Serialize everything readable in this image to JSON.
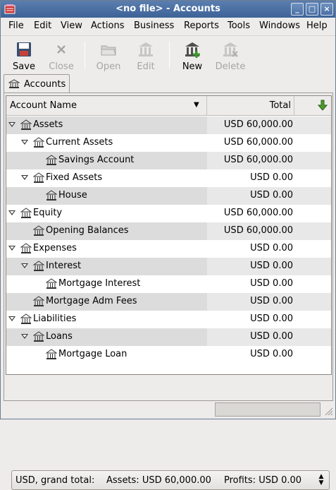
{
  "window": {
    "title": "<no file> - Accounts",
    "controls": {
      "minimize": "_",
      "maximize": "□",
      "close": "×"
    }
  },
  "menubar": [
    "File",
    "Edit",
    "View",
    "Actions",
    "Business",
    "Reports",
    "Tools",
    "Windows",
    "Help"
  ],
  "toolbar": {
    "save": {
      "label": "Save",
      "icon": "floppy-disk-icon",
      "enabled": true
    },
    "close": {
      "label": "Close",
      "icon": "close-x-icon",
      "enabled": false
    },
    "open": {
      "label": "Open",
      "icon": "folder-open-icon",
      "enabled": false
    },
    "edit": {
      "label": "Edit",
      "icon": "account-edit-icon",
      "enabled": false
    },
    "new": {
      "label": "New",
      "icon": "account-new-icon",
      "enabled": true
    },
    "delete": {
      "label": "Delete",
      "icon": "account-delete-icon",
      "enabled": false
    }
  },
  "tab": {
    "label": "Accounts",
    "icon": "bank-icon"
  },
  "columns": {
    "name": "Account Name",
    "total": "Total",
    "name_sort_icon": "chevron-down-icon",
    "selector_icon": "green-down-arrow-icon"
  },
  "accounts": [
    {
      "name": "Assets",
      "total": "USD 60,000.00",
      "level": 0,
      "expanded": true
    },
    {
      "name": "Current Assets",
      "total": "USD 60,000.00",
      "level": 1,
      "expanded": true
    },
    {
      "name": "Savings Account",
      "total": "USD 60,000.00",
      "level": 2,
      "expanded": null
    },
    {
      "name": "Fixed Assets",
      "total": "USD 0.00",
      "level": 1,
      "expanded": true
    },
    {
      "name": "House",
      "total": "USD 0.00",
      "level": 2,
      "expanded": null
    },
    {
      "name": "Equity",
      "total": "USD 60,000.00",
      "level": 0,
      "expanded": true
    },
    {
      "name": "Opening Balances",
      "total": "USD 60,000.00",
      "level": 1,
      "expanded": null
    },
    {
      "name": "Expenses",
      "total": "USD 0.00",
      "level": 0,
      "expanded": true
    },
    {
      "name": "Interest",
      "total": "USD 0.00",
      "level": 1,
      "expanded": true
    },
    {
      "name": "Mortgage Interest",
      "total": "USD 0.00",
      "level": 2,
      "expanded": null
    },
    {
      "name": "Mortgage Adm Fees",
      "total": "USD 0.00",
      "level": 1,
      "expanded": null
    },
    {
      "name": "Liabilities",
      "total": "USD 0.00",
      "level": 0,
      "expanded": true
    },
    {
      "name": "Loans",
      "total": "USD 0.00",
      "level": 1,
      "expanded": true
    },
    {
      "name": "Mortgage Loan",
      "total": "USD 0.00",
      "level": 2,
      "expanded": null
    }
  ],
  "summary": {
    "currency": "USD, grand total:",
    "assets": "Assets: USD 60,000.00",
    "profits": "Profits: USD 0.00"
  },
  "colors": {
    "titlebar": "#3d6298",
    "alt_row": "#dcdcdc",
    "new_plus": "#3a9b2a"
  }
}
